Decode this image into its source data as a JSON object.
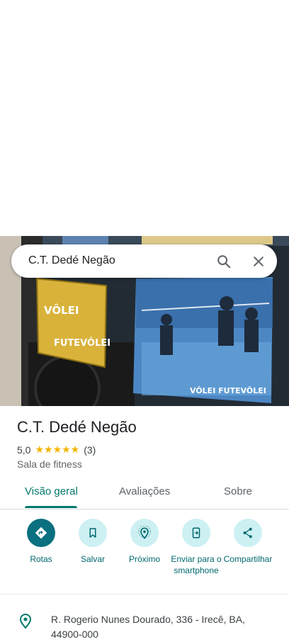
{
  "search": {
    "query": "C.T. Dedé Negão"
  },
  "place": {
    "name": "C.T. Dedé Negão",
    "rating_value": "5,0",
    "stars": "★★★★★",
    "review_count": "(3)",
    "category": "Sala de fitness"
  },
  "hero_image": {
    "sign_text_1": "VÔLEI",
    "sign_text_2": "FUTEVÔLEI",
    "banner_text": "VÔLEI FUTEVÔLEI"
  },
  "tabs": [
    {
      "label": "Visão geral",
      "active": true
    },
    {
      "label": "Avaliações",
      "active": false
    },
    {
      "label": "Sobre",
      "active": false
    }
  ],
  "actions": [
    {
      "label": "Rotas",
      "icon": "directions-icon"
    },
    {
      "label": "Salvar",
      "icon": "bookmark-icon"
    },
    {
      "label": "Próximo",
      "icon": "nearby-icon"
    },
    {
      "label": "Enviar para o smartphone",
      "icon": "send-to-phone-icon"
    },
    {
      "label": "Compartilhar",
      "icon": "share-icon"
    }
  ],
  "address": {
    "text": "R. Rogerio Nunes Dourado, 336 - Irecê, BA, 44900-000",
    "icon": "location-pin-icon"
  },
  "colors": {
    "accent": "#00796b",
    "action_primary": "#0b7080",
    "action_bg": "#cdf0f3",
    "star": "#f4b400"
  }
}
